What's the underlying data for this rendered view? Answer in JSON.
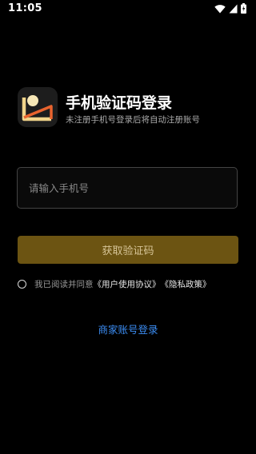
{
  "status_bar": {
    "time": "11:05",
    "icons": [
      "wifi-icon",
      "signal-icon",
      "battery-icon"
    ]
  },
  "header": {
    "title": "手机验证码登录",
    "subtitle": "未注册手机号登录后将自动注册账号"
  },
  "form": {
    "phone_placeholder": "请输入手机号",
    "phone_value": "",
    "get_code_label": "获取验证码"
  },
  "agreement": {
    "prefix": "我已阅读并同意",
    "user_agreement": "《用户使用协议》",
    "privacy_policy": "《隐私政策》",
    "checked": false
  },
  "merchant_login_label": "商家账号登录",
  "colors": {
    "background": "#000000",
    "button": "#6c5412",
    "button_text": "#d6c497",
    "link": "#3b8cf2"
  }
}
